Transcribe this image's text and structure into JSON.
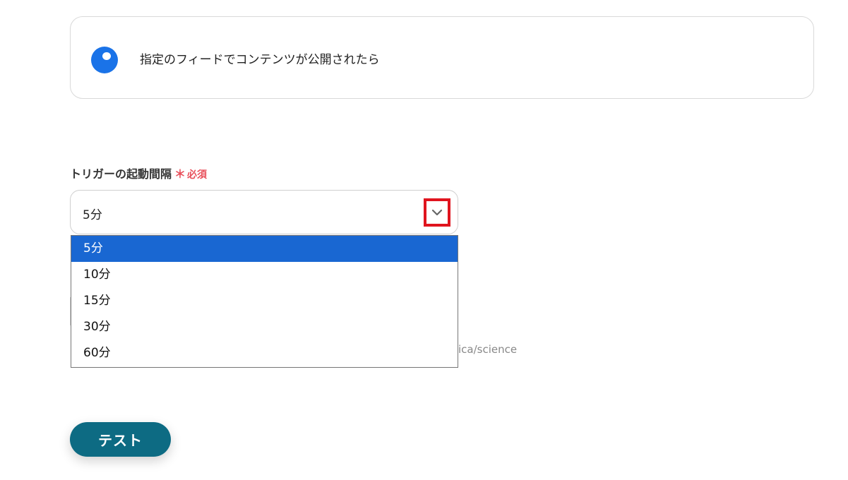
{
  "trigger": {
    "title": "指定のフィードでコンテンツが公開されたら"
  },
  "interval_field": {
    "label": "トリガーの起動間隔",
    "required_mark": "＊",
    "required_text": "必須",
    "selected_value": "5分",
    "options": [
      "5分",
      "10分",
      "15分",
      "30分",
      "60分"
    ],
    "selected_index": 0
  },
  "partially_hidden_hint": "ica/science",
  "actions": {
    "test_label": "テスト"
  },
  "colors": {
    "accent_blue": "#1a73e8",
    "selected_option": "#1967d2",
    "required": "#e8505b",
    "highlight_box": "#e0141e",
    "test_button": "#0d6b83"
  }
}
